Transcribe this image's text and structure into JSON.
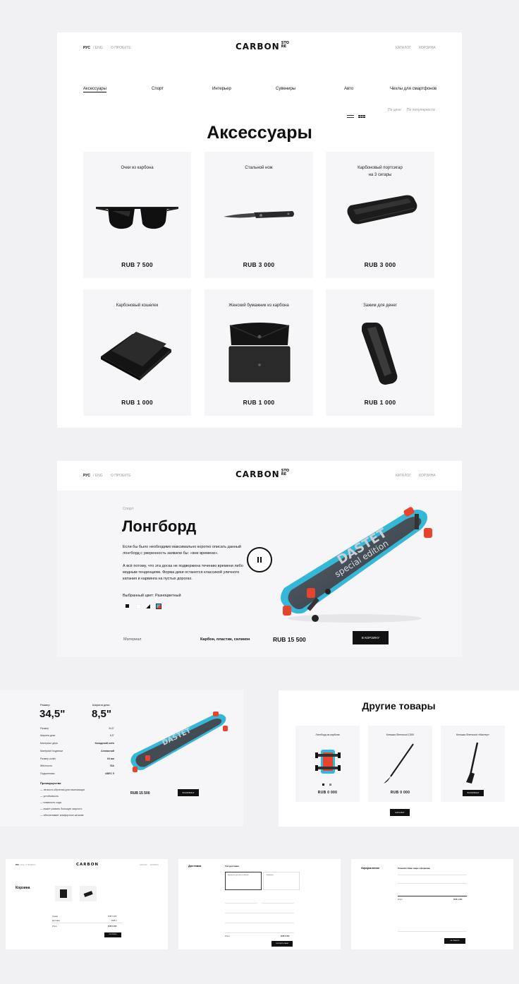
{
  "header": {
    "lang_ru": "РУС",
    "lang_en": "/ ENG",
    "about": "О ПРОЕКТЕ",
    "logo": "CARBON",
    "logo_sub1": "STO",
    "logo_sub2": "RE",
    "catalog": "КАТАЛОГ",
    "cart": "КОРЗИНА"
  },
  "catalog": {
    "categories": [
      "Аксессуары",
      "Спорт",
      "Интерьер",
      "Сувениры",
      "Авто",
      "Чехлы для смартфонов"
    ],
    "sort_price": "По цене",
    "sort_popular": "По популярности",
    "title": "Аксессуары",
    "products": [
      {
        "name": "Очки из карбона",
        "price": "RUB  7 500",
        "icon": "sunglasses-icon"
      },
      {
        "name": "Стальной нож",
        "price": "RUB  3 000",
        "icon": "knife-icon"
      },
      {
        "name": "Карбоновый портсигар",
        "name2": "на 3 сигары",
        "price": "RUB  3 000",
        "icon": "cigar-case-icon"
      },
      {
        "name": "Карбоновый кошелек",
        "price": "RUB  1 000",
        "icon": "wallet-icon"
      },
      {
        "name": "Женский бумажник из карбона",
        "price": "RUB  1 000",
        "icon": "purse-icon"
      },
      {
        "name": "Зажим для денег",
        "price": "RUB  1 000",
        "icon": "money-clip-icon"
      }
    ]
  },
  "product": {
    "category": "Спорт",
    "title": "Лонгборд",
    "desc1": "Если бы было необходимо максимально коротко описать данный",
    "desc2": "лонгборд с уверенность заявили бы: «вне времени».",
    "desc3": "А всё потому, что эта доска не подвержена течению времени либо",
    "desc4": "модным тенденциям. Форма деки останется классикой уличного",
    "desc5": "катания и карвинга на пустых дорогах.",
    "color_label": "Выбранный цвет:",
    "color_value": "Разноцветный",
    "material_label": "Материал",
    "material_value": "Карбон, пластик, силикон",
    "price": "RUB  15 500",
    "buy": "В КОРЗИНУ",
    "board_text1": "DASTET",
    "board_text2": "special edition"
  },
  "specs": {
    "size_label": "Размер",
    "size_value": "34,5\"",
    "width_label": "Ширина деки",
    "width_value": "8,5\"",
    "rows": [
      [
        "Размер",
        "34,5\""
      ],
      [
        "Ширина деки",
        "8,5\""
      ],
      [
        "Материал деки",
        "Канадский клён"
      ],
      [
        "Материал подвески",
        "Алюминий"
      ],
      [
        "Размер колёс",
        "64 мм"
      ],
      [
        "Жёсткость",
        "78A"
      ],
      [
        "Подшипники",
        "ABEC 5"
      ]
    ],
    "advantages_title": "Преимущества",
    "advantages": [
      "— легкость обучения для начинающих",
      "— устойчивость",
      "— плавность хода",
      "— может развить большую скорость",
      "— обеспечивает комфортное катание"
    ],
    "price": "RUB  15 500",
    "buy": "В КОРЗИНУ"
  },
  "others": {
    "title": "Другие товары",
    "items": [
      {
        "name": "Лонгборд из карбона",
        "price": "RUB  0 000"
      },
      {
        "name": "Клюшка Sherwood С300",
        "price": "RUB  0 000"
      },
      {
        "name": "Клюшка Sherwood «Мастер»",
        "price": "",
        "buy": "В КОРЗИНУ"
      }
    ],
    "catalog_btn": "КАТАЛОГ"
  },
  "cart_panel": {
    "title": "Корзина",
    "sum1_label": "Сумма",
    "sum1_value": "RUB  3 000",
    "sum2_label": "Доставка",
    "sum2_value": "RUB  0",
    "total_label": "Итого",
    "total_value": "RUB  6 000",
    "checkout": "ОФОРМИТЬ"
  },
  "delivery_panel": {
    "title": "Доставка",
    "subtitle": "Тип доставки",
    "option1": "Курьерская доставка по Москве",
    "option2": "Самовывоз",
    "total_label": "Итого",
    "total_value": "RUB  9 000",
    "next": "ОФОРМИТЬ ЗАКАЗ"
  },
  "confirm_panel": {
    "title": "Оформление",
    "subtitle": "Спасибо! Ваш заказ оформлен",
    "total_label": "Итого",
    "total_value": "RUB  4 200",
    "ok": "НА ГЛАВНУЮ"
  },
  "colors": {
    "background": "#f1f1f4",
    "card": "#f6f6f8",
    "accent_blue": "#35b8d8",
    "wheel_red": "#e8432d",
    "black": "#111111"
  }
}
